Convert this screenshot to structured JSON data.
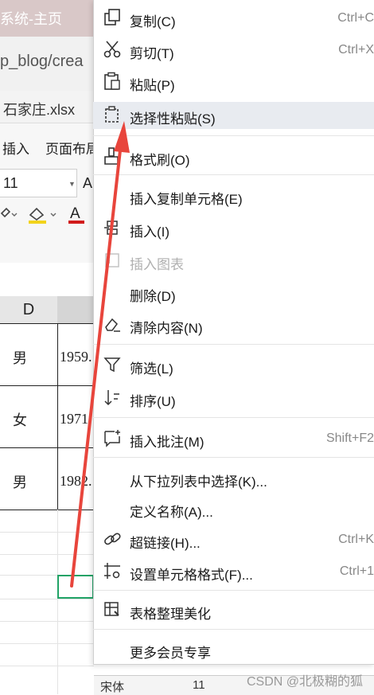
{
  "window": {
    "title": "系统-主页"
  },
  "browser": {
    "url": "p_blog/crea"
  },
  "workbook": {
    "file_tab": "石家庄.xlsx"
  },
  "ribbon": {
    "tabs": [
      "插入",
      "页面布局"
    ],
    "font_size": "11",
    "font_glyph": "A"
  },
  "sheet": {
    "column_header": "D",
    "rows": [
      {
        "gender": "男",
        "year": "1959."
      },
      {
        "gender": "女",
        "year": "1971"
      },
      {
        "gender": "男",
        "year": "1982."
      }
    ]
  },
  "menu": {
    "items": [
      {
        "label": "复制(C)",
        "shortcut": "Ctrl+C",
        "icon": "copy-icon"
      },
      {
        "label": "剪切(T)",
        "shortcut": "Ctrl+X",
        "icon": "scissors-icon"
      },
      {
        "label": "粘贴(P)",
        "shortcut": "",
        "icon": "paste-icon"
      },
      {
        "label": "选择性粘贴(S)",
        "shortcut": "",
        "icon": "paste-special-icon",
        "highlighted": true
      },
      {
        "label": "格式刷(O)",
        "shortcut": "",
        "icon": "format-brush-icon"
      },
      {
        "label": "插入复制单元格(E)",
        "shortcut": "",
        "icon": ""
      },
      {
        "label": "插入(I)",
        "shortcut": "",
        "icon": "insert-icon"
      },
      {
        "label": "插入图表",
        "shortcut": "",
        "icon": "chart-icon",
        "disabled": true
      },
      {
        "label": "删除(D)",
        "shortcut": "",
        "icon": ""
      },
      {
        "label": "清除内容(N)",
        "shortcut": "",
        "icon": "eraser-icon"
      },
      {
        "label": "筛选(L)",
        "shortcut": "",
        "icon": "filter-icon"
      },
      {
        "label": "排序(U)",
        "shortcut": "",
        "icon": "sort-icon"
      },
      {
        "label": "插入批注(M)",
        "shortcut": "Shift+F2",
        "icon": "comment-icon"
      },
      {
        "label": "从下拉列表中选择(K)...",
        "shortcut": "",
        "icon": ""
      },
      {
        "label": "定义名称(A)...",
        "shortcut": "",
        "icon": ""
      },
      {
        "label": "超链接(H)...",
        "shortcut": "Ctrl+K",
        "icon": "link-icon"
      },
      {
        "label": "设置单元格格式(F)...",
        "shortcut": "Ctrl+1",
        "icon": "cell-format-icon"
      },
      {
        "label": "表格整理美化",
        "shortcut": "",
        "icon": "table-beautify-icon"
      },
      {
        "label": "更多会员专享",
        "shortcut": "",
        "icon": ""
      }
    ]
  },
  "bottom_toolbar": {
    "font_name": "宋体",
    "font_size": "11"
  },
  "watermark": "CSDN @北极糊的狐",
  "colors": {
    "highlight": "#e8ebf0",
    "arrow": "#e8453c",
    "selection": "#21a366"
  }
}
